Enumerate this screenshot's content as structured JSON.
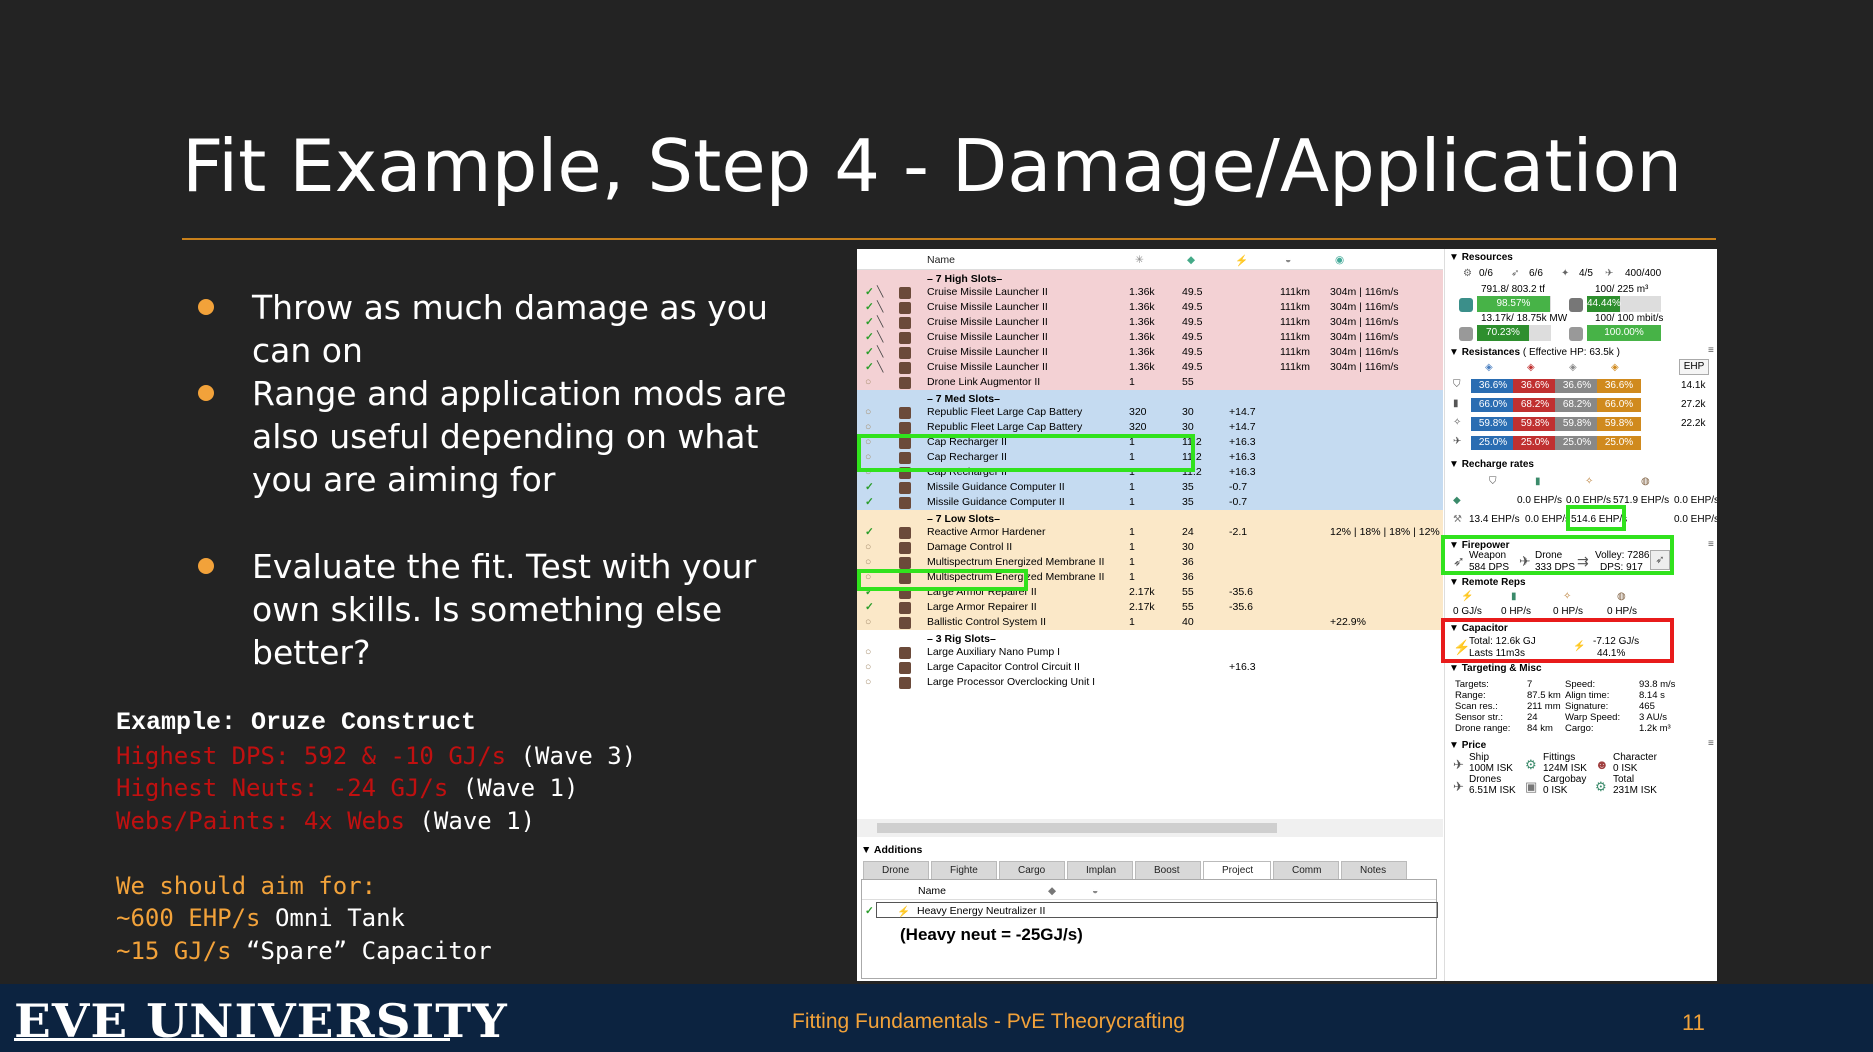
{
  "slide": {
    "title": "Fit Example, Step 4 - Damage/Application",
    "bullets": [
      "Throw as much damage as you can on",
      "Range and application mods are also useful depending on what you are aiming for",
      "Evaluate the fit. Test with your own skills. Is something else better?"
    ],
    "example": {
      "heading": "Example: Oruze Construct",
      "line1_red": "Highest DPS: 592 & -10 GJ/s",
      "line1_white": " (Wave 3)",
      "line2_red": "Highest Neuts: -24 GJ/s",
      "line2_white": " (Wave 1)",
      "line3_red": "Webs/Paints: 4x Webs",
      "line3_white": " (Wave 1)",
      "aim_heading": "We should aim for:",
      "aim1_orange": "~600 EHP/s",
      "aim1_white": " Omni Tank",
      "aim2_orange": "~15 GJ/s",
      "aim2_white": " “Spare” Capacitor"
    },
    "footer": {
      "logo": "EVE UNIVERSITY",
      "center": "Fitting Fundamentals - PvE Theorycrafting",
      "page": "11"
    }
  },
  "fitting": {
    "header": {
      "name": "Name"
    },
    "sections": {
      "high": "– 7 High Slots–",
      "med": "– 7 Med Slots–",
      "low": "– 7 Low Slots–",
      "rig": "– 3 Rig Slots–"
    },
    "high": [
      {
        "name": "Cruise Missile Launcher II",
        "c1": "1.36k",
        "c2": "49.5",
        "c3": "",
        "c4": "111km",
        "c5": "304m | 116m/s"
      },
      {
        "name": "Cruise Missile Launcher II",
        "c1": "1.36k",
        "c2": "49.5",
        "c3": "",
        "c4": "111km",
        "c5": "304m | 116m/s"
      },
      {
        "name": "Cruise Missile Launcher II",
        "c1": "1.36k",
        "c2": "49.5",
        "c3": "",
        "c4": "111km",
        "c5": "304m | 116m/s"
      },
      {
        "name": "Cruise Missile Launcher II",
        "c1": "1.36k",
        "c2": "49.5",
        "c3": "",
        "c4": "111km",
        "c5": "304m | 116m/s"
      },
      {
        "name": "Cruise Missile Launcher II",
        "c1": "1.36k",
        "c2": "49.5",
        "c3": "",
        "c4": "111km",
        "c5": "304m | 116m/s"
      },
      {
        "name": "Cruise Missile Launcher II",
        "c1": "1.36k",
        "c2": "49.5",
        "c3": "",
        "c4": "111km",
        "c5": "304m | 116m/s"
      },
      {
        "name": "Drone Link Augmentor II",
        "c1": "1",
        "c2": "55",
        "c3": "",
        "c4": "",
        "c5": ""
      }
    ],
    "med": [
      {
        "name": "Republic Fleet Large Cap Battery",
        "c1": "320",
        "c2": "30",
        "c3": "+14.7",
        "c4": "",
        "c5": ""
      },
      {
        "name": "Republic Fleet Large Cap Battery",
        "c1": "320",
        "c2": "30",
        "c3": "+14.7",
        "c4": "",
        "c5": ""
      },
      {
        "name": "Cap Recharger II",
        "c1": "1",
        "c2": "11.2",
        "c3": "+16.3",
        "c4": "",
        "c5": ""
      },
      {
        "name": "Cap Recharger II",
        "c1": "1",
        "c2": "11.2",
        "c3": "+16.3",
        "c4": "",
        "c5": ""
      },
      {
        "name": "Cap Recharger II",
        "c1": "1",
        "c2": "11.2",
        "c3": "+16.3",
        "c4": "",
        "c5": ""
      },
      {
        "name": "Missile Guidance Computer II",
        "c1": "1",
        "c2": "35",
        "c3": "-0.7",
        "c4": "",
        "c5": ""
      },
      {
        "name": "Missile Guidance Computer II",
        "c1": "1",
        "c2": "35",
        "c3": "-0.7",
        "c4": "",
        "c5": ""
      }
    ],
    "low": [
      {
        "name": "Reactive Armor Hardener",
        "c1": "1",
        "c2": "24",
        "c3": "-2.1",
        "c4": "",
        "c5": "12% | 18% | 18% | 12%"
      },
      {
        "name": "Damage Control II",
        "c1": "1",
        "c2": "30",
        "c3": "",
        "c4": "",
        "c5": ""
      },
      {
        "name": "Multispectrum Energized Membrane II",
        "c1": "1",
        "c2": "36",
        "c3": "",
        "c4": "",
        "c5": ""
      },
      {
        "name": "Multispectrum Energized Membrane II",
        "c1": "1",
        "c2": "36",
        "c3": "",
        "c4": "",
        "c5": ""
      },
      {
        "name": "Large Armor Repairer II",
        "c1": "2.17k",
        "c2": "55",
        "c3": "-35.6",
        "c4": "",
        "c5": ""
      },
      {
        "name": "Large Armor Repairer II",
        "c1": "2.17k",
        "c2": "55",
        "c3": "-35.6",
        "c4": "",
        "c5": ""
      },
      {
        "name": "Ballistic Control System II",
        "c1": "1",
        "c2": "40",
        "c3": "",
        "c4": "",
        "c5": "+22.9%"
      }
    ],
    "rig": [
      {
        "name": "Large Auxiliary Nano Pump I",
        "c1": "",
        "c2": "",
        "c3": "",
        "c4": "",
        "c5": ""
      },
      {
        "name": "Large Capacitor Control Circuit II",
        "c1": "",
        "c2": "",
        "c3": "+16.3",
        "c4": "",
        "c5": ""
      },
      {
        "name": "Large Processor Overclocking Unit I",
        "c1": "",
        "c2": "",
        "c3": "",
        "c4": "",
        "c5": ""
      }
    ],
    "additions": {
      "title": "Additions",
      "tabs": [
        "Drone",
        "Fighte",
        "Cargo",
        "Implan",
        "Boost",
        "Project",
        "Comm",
        "Notes"
      ],
      "col_name": "Name",
      "row_name": "Heavy Energy Neutralizer II",
      "note": "(Heavy neut = -25GJ/s)"
    }
  },
  "stats": {
    "resources": {
      "title": "Resources",
      "turret": "0/6",
      "launcher": "6/6",
      "calib": "4/5",
      "drone_bw_small": "400/400",
      "cpu": "791.8/ 803.2 tf",
      "cpu_pct": "98.57%",
      "cpu_fill": 0.9857,
      "bay": "100/ 225 m³",
      "bay_pct": "44.44%",
      "bay_fill": 0.4444,
      "pg": "13.17k/ 18.75k MW",
      "pg_pct": "70.23%",
      "pg_fill": 0.7023,
      "bw": "100/ 100 mbit/s",
      "bw_pct": "100.00%",
      "bw_fill": 1.0
    },
    "resistances": {
      "title": "Resistances",
      "ehp": "( Effective HP: 63.5k )",
      "ehp_btn": "EHP",
      "rows": [
        {
          "em": "36.6%",
          "th": "36.6%",
          "ki": "36.6%",
          "ex": "36.6%",
          "hp": "14.1k"
        },
        {
          "em": "66.0%",
          "th": "68.2%",
          "ki": "68.2%",
          "ex": "66.0%",
          "hp": "27.2k"
        },
        {
          "em": "59.8%",
          "th": "59.8%",
          "ki": "59.8%",
          "ex": "59.8%",
          "hp": "22.2k"
        },
        {
          "em": "25.0%",
          "th": "25.0%",
          "ki": "25.0%",
          "ex": "25.0%",
          "hp": ""
        }
      ]
    },
    "recharge": {
      "title": "Recharge rates",
      "r1": [
        "0.0 EHP/s",
        "0.0 EHP/s",
        "571.9 EHP/s",
        "0.0 EHP/s"
      ],
      "r2": [
        "13.4 EHP/s",
        "0.0 EHP/s",
        "514.6 EHP/s",
        "0.0 EHP/s"
      ]
    },
    "firepower": {
      "title": "Firepower",
      "weapon_label": "Weapon",
      "weapon": "584 DPS",
      "drone_label": "Drone",
      "drone": "333 DPS",
      "volley": "Volley: 7286",
      "dps": "DPS: 917"
    },
    "remote": {
      "title": "Remote Reps",
      "vals": [
        "0 GJ/s",
        "0 HP/s",
        "0 HP/s",
        "0 HP/s"
      ]
    },
    "capacitor": {
      "title": "Capacitor",
      "total": "Total: 12.6k GJ",
      "lasts": "Lasts 11m3s",
      "delta": "-7.12 GJ/s",
      "pct": "44.1%"
    },
    "targeting": {
      "title": "Targeting & Misc",
      "left": [
        [
          "Targets:",
          "7"
        ],
        [
          "Range:",
          "87.5 km"
        ],
        [
          "Scan res.:",
          "211 mm"
        ],
        [
          "Sensor str.:",
          "24"
        ],
        [
          "Drone range:",
          "84 km"
        ]
      ],
      "right": [
        [
          "Speed:",
          "93.8 m/s"
        ],
        [
          "Align time:",
          "8.14 s"
        ],
        [
          "Signature:",
          "465"
        ],
        [
          "Warp Speed:",
          "3 AU/s"
        ],
        [
          "Cargo:",
          "1.2k m³"
        ]
      ]
    },
    "price": {
      "title": "Price",
      "ship_label": "Ship",
      "ship": "100M ISK",
      "fittings_label": "Fittings",
      "fittings": "124M ISK",
      "character_label": "Character",
      "character": "0 ISK",
      "drones_label": "Drones",
      "drones": "6.51M ISK",
      "cargobay_label": "Cargobay",
      "cargobay": "0 ISK",
      "total_label": "Total",
      "total": "231M ISK"
    }
  },
  "colors": {
    "accent": "#f2a23a",
    "highlight_green": "#31e21d",
    "highlight_red": "#e81b1b",
    "footer_bg": "#0c2340"
  }
}
